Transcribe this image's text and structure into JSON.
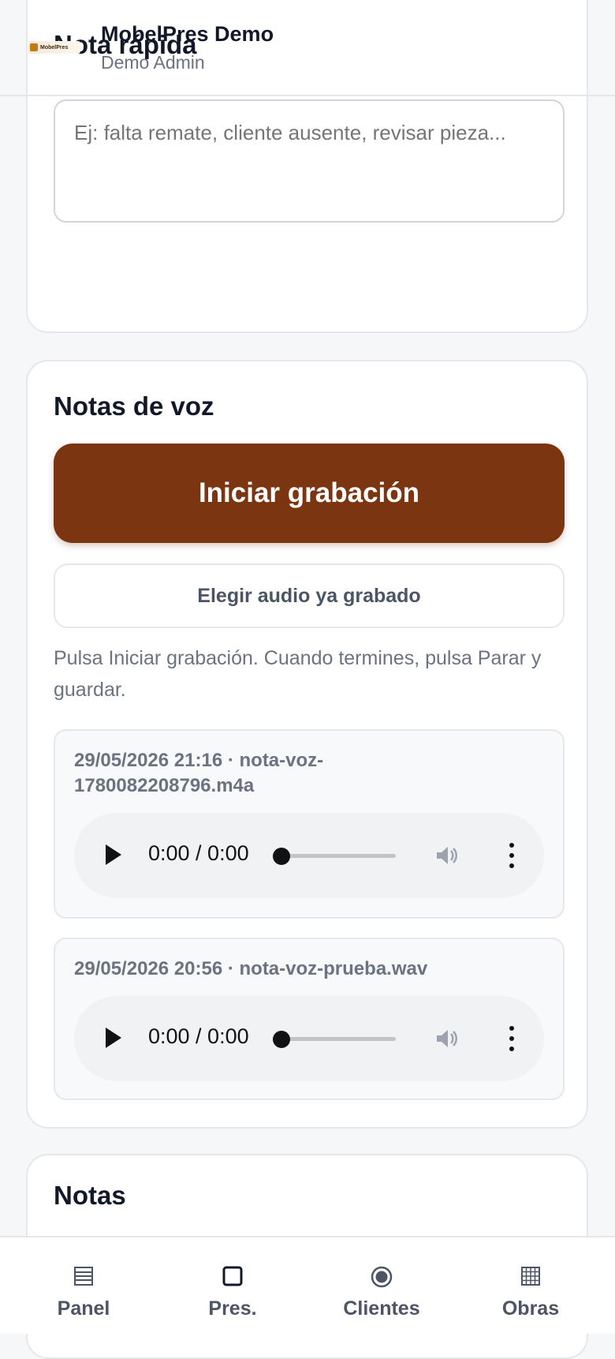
{
  "header": {
    "title": "MobelPres Demo",
    "user": "Demo Admin",
    "logo_text": "MobelPres"
  },
  "quick_note": {
    "title": "Nota rápida",
    "placeholder": "Ej: falta remate, cliente ausente, revisar pieza..."
  },
  "voice_notes": {
    "title": "Notas de voz",
    "record_label": "Iniciar grabación",
    "choose_label": "Elegir audio ya grabado",
    "hint": "Pulsa Iniciar grabación. Cuando termines, pulsa Parar y guardar.",
    "items": [
      {
        "meta": "29/05/2026 21:16 · nota-voz-1780082208796.m4a",
        "time": "0:00 / 0:00"
      },
      {
        "meta": "29/05/2026 20:56 · nota-voz-prueba.wav",
        "time": "0:00 / 0:00"
      }
    ]
  },
  "notes": {
    "title": "Notas"
  },
  "nav": {
    "items": [
      {
        "label": "Panel",
        "icon": "ledger-icon"
      },
      {
        "label": "Pres.",
        "icon": "square-icon"
      },
      {
        "label": "Clientes",
        "icon": "radio-circle-icon"
      },
      {
        "label": "Obras",
        "icon": "grid-icon"
      }
    ]
  },
  "colors": {
    "accent": "#7c3511"
  }
}
